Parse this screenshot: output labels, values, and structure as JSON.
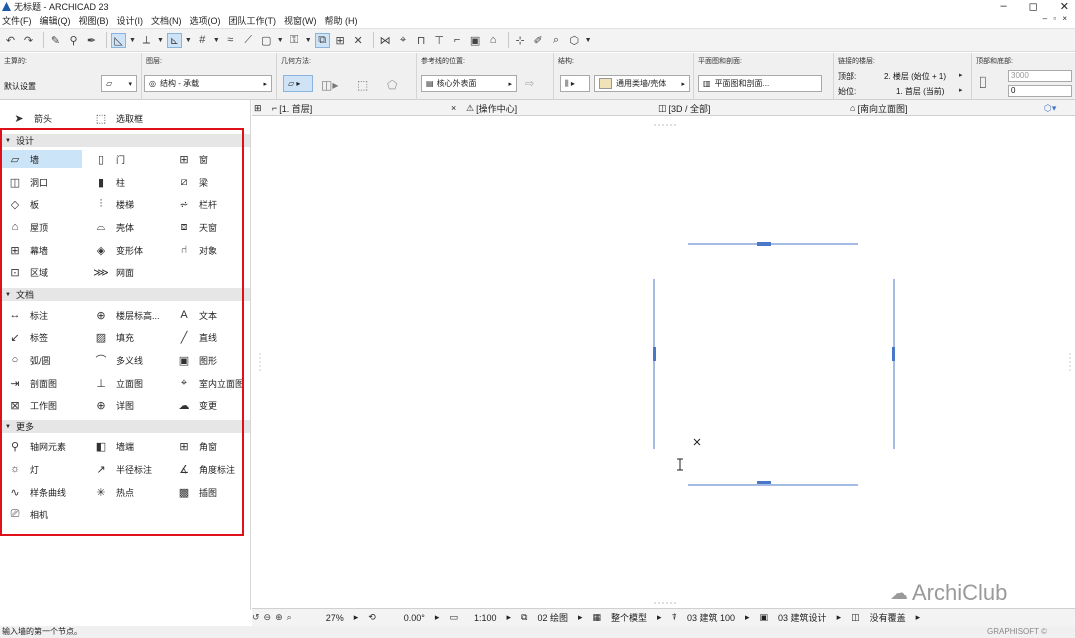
{
  "window": {
    "title": "无标题 - ARCHICAD 23",
    "controls": [
      "–",
      "◻",
      "✕"
    ]
  },
  "menu": [
    "文件(F)",
    "编辑(Q)",
    "视图(B)",
    "设计(I)",
    "文档(N)",
    "选项(O)",
    "团队工作(T)",
    "视窗(W)",
    "帮助 (H)"
  ],
  "infobox": {
    "main_label": "主算的:",
    "main_value": "默认设置",
    "layer_label": "图层:",
    "layer_value": "结构 - 承载",
    "geometry_label": "几何方法:",
    "refline_label": "参考线的位置:",
    "refline_value": "核心外表面",
    "structure_label": "结构:",
    "structure_value": "通用类墙/壳体",
    "floorplan_label": "平面图和剖面:",
    "floorplan_value": "平面图和剖面...",
    "linked_label": "链接的楼层:",
    "top_label": "顶部:",
    "top_value": "2. 楼层 (始位 + 1)",
    "base_label": "始位:",
    "base_value": "1. 首层 (当前)",
    "topbottom_label": "顶部和底部:",
    "height_value": "3000",
    "offset_value": "0"
  },
  "toolbox": {
    "arrow": "箭头",
    "marquee": "选取框",
    "groups": [
      {
        "title": "设计",
        "tools": [
          "墙",
          "门",
          "窗",
          "洞口",
          "柱",
          "梁",
          "板",
          "楼梯",
          "栏杆",
          "屋顶",
          "壳体",
          "天窗",
          "幕墙",
          "变形体",
          "对象",
          "区域",
          "网面"
        ]
      },
      {
        "title": "文档",
        "tools": [
          "标注",
          "楼层标高...",
          "文本",
          "标签",
          "填充",
          "直线",
          "弧/圆",
          "多义线",
          "图形",
          "剖面图",
          "立面图",
          "室内立面图",
          "工作图",
          "详图",
          "变更"
        ]
      },
      {
        "title": "更多",
        "tools": [
          "轴网元素",
          "墙端",
          "角窗",
          "灯",
          "半径标注",
          "角度标注",
          "样条曲线",
          "热点",
          "插图",
          "相机"
        ]
      }
    ]
  },
  "tabs": [
    {
      "label": "[1. 首层]",
      "closable": "×"
    },
    {
      "label": "[操作中心]"
    },
    {
      "label": "[3D / 全部]"
    },
    {
      "label": "[南向立面图]"
    }
  ],
  "statusbar": {
    "zoom": "27%",
    "angle": "0.00°",
    "scale": "1:100",
    "layer_combo": "02 绘图",
    "model_view": "整个模型",
    "pen_set": "03 建筑 100",
    "mvo": "03 建筑设计",
    "override": "没有覆盖"
  },
  "message": "输入墙的第一个节点。",
  "brand": "GRAPHISOFT ©",
  "watermark": "ArchiClub",
  "colors": {
    "highlight_box": "#e0101a",
    "selected_tool": "#cce4f7",
    "drawing_line": "#4a78c8"
  }
}
